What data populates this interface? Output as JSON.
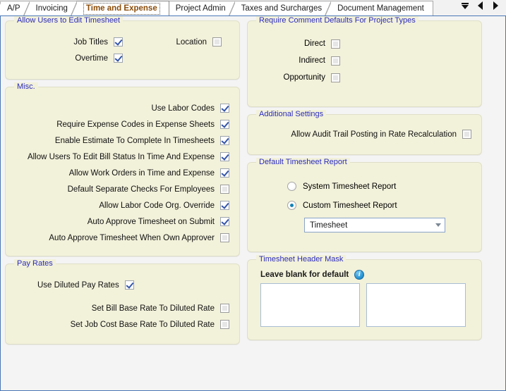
{
  "tabs": [
    {
      "label": "A/P",
      "active": false
    },
    {
      "label": "Invoicing",
      "active": false
    },
    {
      "label": "Time and Expense",
      "active": true
    },
    {
      "label": "Project Admin",
      "active": false
    },
    {
      "label": "Taxes and Surcharges",
      "active": false
    },
    {
      "label": "Document Management",
      "active": false
    }
  ],
  "tab_nav": {
    "list_label": "tab-list-dropdown",
    "prev_label": "previous-tab",
    "next_label": "next-tab"
  },
  "left": {
    "allow_edit": {
      "title": "Allow Users to Edit Timesheet",
      "rows": [
        {
          "label": "Job Titles",
          "checked": true,
          "label2": "Location",
          "checked2": false
        },
        {
          "label": "Overtime",
          "checked": true,
          "label2": "",
          "checked2": null
        }
      ]
    },
    "misc": {
      "title": "Misc.",
      "items": [
        {
          "label": "Use Labor Codes",
          "checked": true
        },
        {
          "label": "Require Expense Codes in Expense Sheets",
          "checked": true
        },
        {
          "label": "Enable Estimate To Complete In Timesheets",
          "checked": true
        },
        {
          "label": "Allow Users To Edit Bill Status In Time And Expense",
          "checked": true
        },
        {
          "label": "Allow Work Orders in Time and Expense",
          "checked": true
        },
        {
          "label": "Default Separate Checks For Employees",
          "checked": false
        },
        {
          "label": "Allow Labor Code Org. Override",
          "checked": true
        },
        {
          "label": "Auto Approve Timesheet on Submit",
          "checked": true
        },
        {
          "label": "Auto Approve Timesheet When Own Approver",
          "checked": false
        }
      ]
    },
    "pay_rates": {
      "title": "Pay Rates",
      "primary": {
        "label": "Use Diluted Pay Rates",
        "checked": true
      },
      "items": [
        {
          "label": "Set Bill Base Rate To Diluted Rate",
          "checked": false
        },
        {
          "label": "Set Job Cost Base Rate To Diluted Rate",
          "checked": false
        }
      ]
    }
  },
  "right": {
    "comment_defaults": {
      "title": "Require Comment Defaults For Project Types",
      "items": [
        {
          "label": "Direct",
          "checked": false
        },
        {
          "label": "Indirect",
          "checked": false
        },
        {
          "label": "Opportunity",
          "checked": false
        }
      ]
    },
    "additional": {
      "title": "Additional Settings",
      "items": [
        {
          "label": "Allow Audit Trail Posting in Rate Recalculation",
          "checked": false
        }
      ]
    },
    "default_report": {
      "title": "Default Timesheet Report",
      "options": [
        {
          "label": "System Timesheet Report",
          "selected": false
        },
        {
          "label": "Custom Timesheet Report",
          "selected": true
        }
      ],
      "dropdown_value": "Timesheet"
    },
    "header_mask": {
      "title": "Timesheet Header Mask",
      "hint": "Leave blank for default",
      "info_glyph": "i",
      "box1_value": "",
      "box2_value": ""
    }
  }
}
